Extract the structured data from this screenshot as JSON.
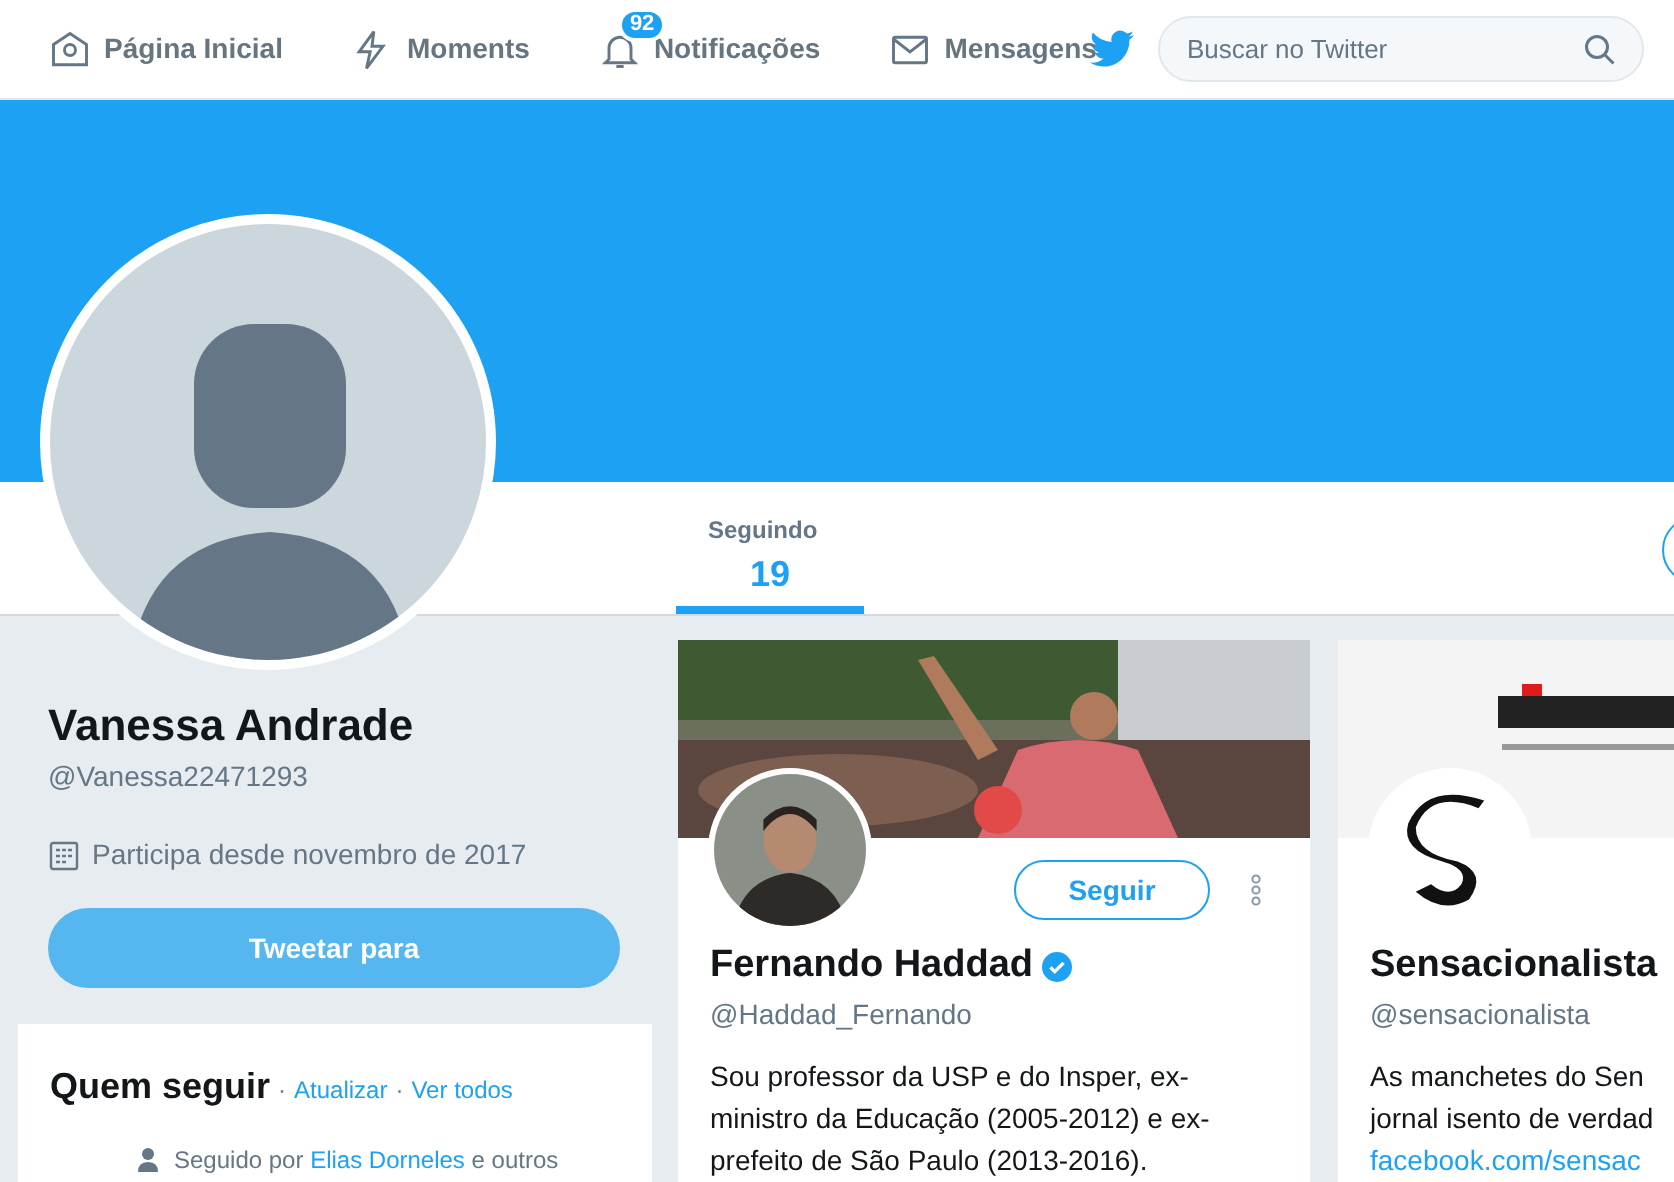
{
  "nav": {
    "items": [
      {
        "kind": "home",
        "label": "Página Inicial"
      },
      {
        "kind": "moments",
        "label": "Moments"
      },
      {
        "kind": "notifications",
        "label": "Notificações",
        "badge": "92"
      },
      {
        "kind": "messages",
        "label": "Mensagens"
      }
    ],
    "search": {
      "placeholder": "Buscar no Twitter"
    }
  },
  "profile": {
    "name": "Vanessa Andrade",
    "handle": "@Vanessa22471293",
    "joined": "Participa desde novembro de 2017",
    "tweet_button": "Tweetar para"
  },
  "tabs": [
    {
      "label": "Seguindo",
      "count": "19",
      "selected": true
    }
  ],
  "who_to_follow": {
    "title": "Quem seguir",
    "separator": "·",
    "links": [
      "Atualizar",
      "Ver todos"
    ],
    "followed_by": {
      "prefix": "Seguido por",
      "name": "Elias Dorneles",
      "suffix": "e outros"
    }
  },
  "cards": [
    {
      "name": "Fernando Haddad",
      "verified": true,
      "handle": "@Haddad_Fernando",
      "follow_button": "Seguir",
      "bio": [
        "Sou professor da USP e do Insper, ex-",
        "ministro da Educação (2005-2012) e ex-",
        "prefeito de São Paulo (2013-2016)."
      ]
    },
    {
      "name": "Sensacionalista",
      "verified": false,
      "handle": "@sensacionalista",
      "bio": [
        "As manchetes do Sen",
        "jornal isento de verdad"
      ],
      "link": "facebook.com/sensac"
    }
  ]
}
